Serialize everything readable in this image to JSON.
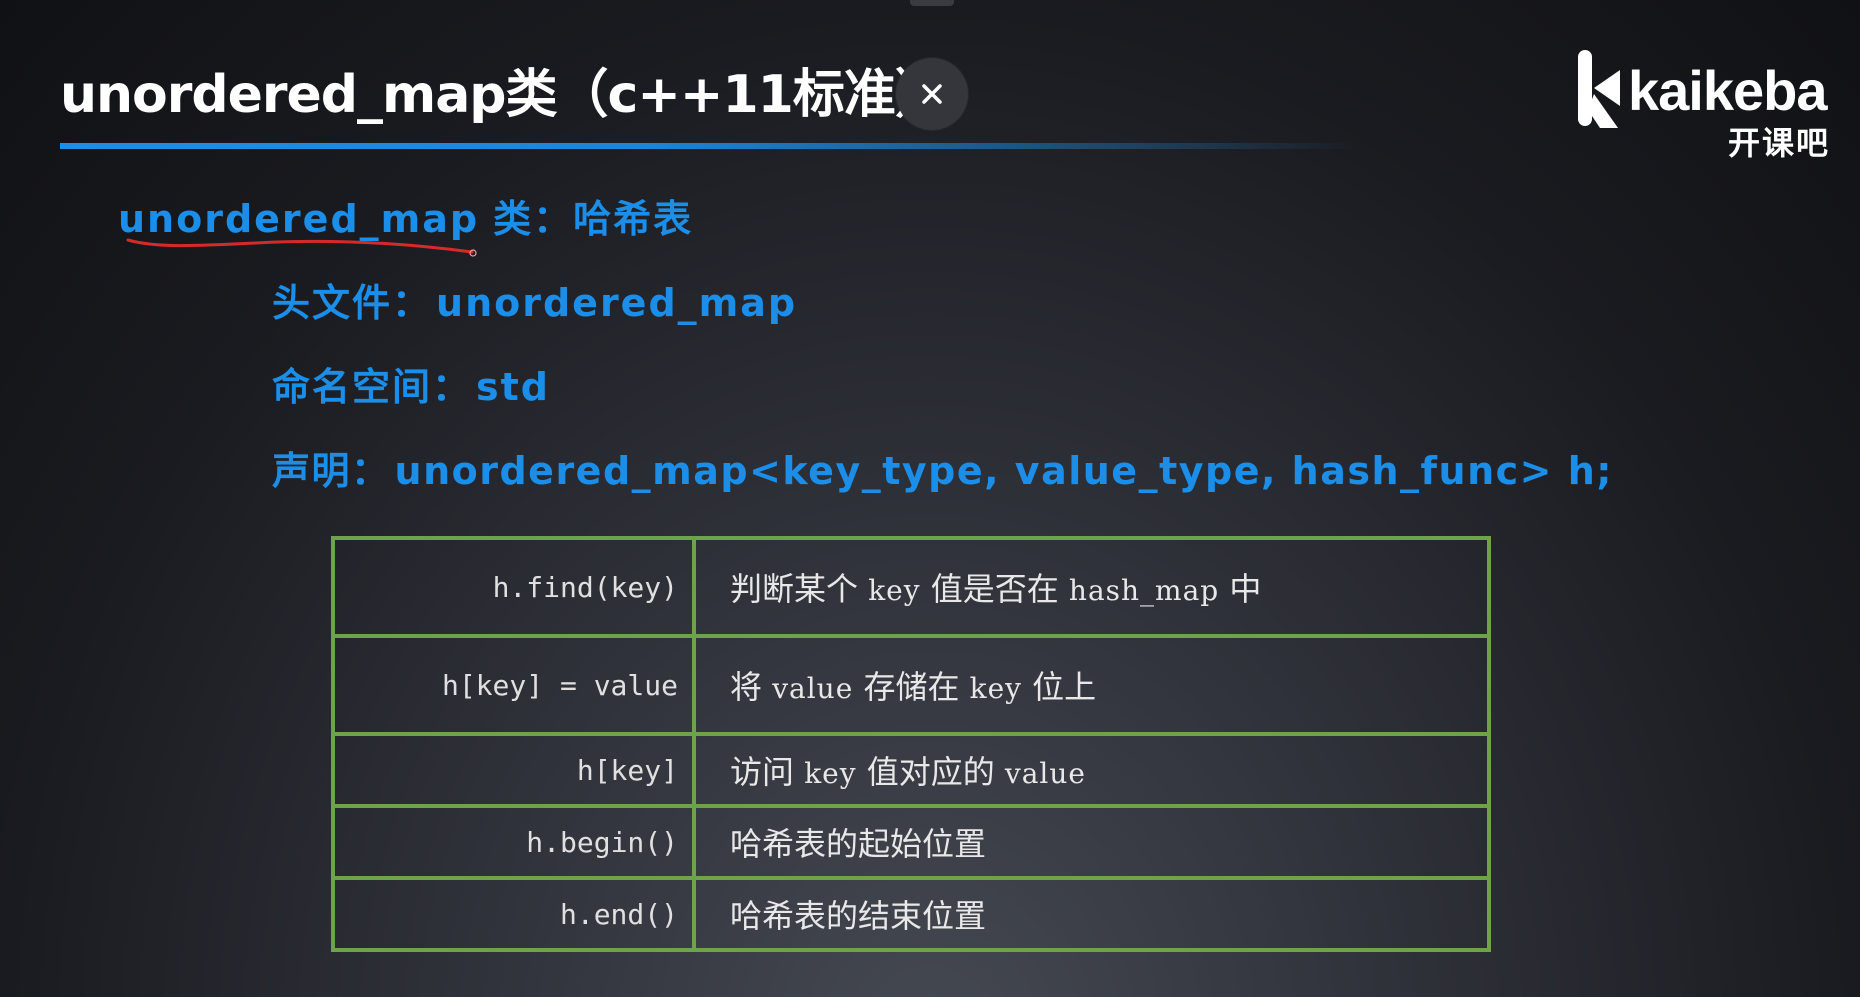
{
  "slide": {
    "title": "unordered_map类（c++11标准）",
    "close_label": "×",
    "logo": {
      "wordmark": "kaikeba",
      "chinese": "开课吧"
    }
  },
  "heading": {
    "term": "unordered_map",
    "label": "类：",
    "text": "哈希表"
  },
  "details": {
    "header_label": "头文件：",
    "header_value": "unordered_map",
    "namespace_label": "命名空间：",
    "namespace_value": "std",
    "decl_label": "声明：",
    "decl_value": "unordered_map<key_type, value_type, hash_func> h;"
  },
  "table": {
    "rows": [
      {
        "op": "h.find(key)",
        "desc": [
          {
            "text": "判断某个 ",
            "mono": false
          },
          {
            "text": "key",
            "mono": true
          },
          {
            "text": " 值是否在 ",
            "mono": false
          },
          {
            "text": "hash_map",
            "mono": true
          },
          {
            "text": " 中",
            "mono": false
          }
        ]
      },
      {
        "op": "h[key] = value",
        "desc": [
          {
            "text": "将 ",
            "mono": false
          },
          {
            "text": "value",
            "mono": true
          },
          {
            "text": " 存储在 ",
            "mono": false
          },
          {
            "text": "key",
            "mono": true
          },
          {
            "text": " 位上",
            "mono": false
          }
        ]
      },
      {
        "op": "h[key]",
        "desc": [
          {
            "text": "访问 ",
            "mono": false
          },
          {
            "text": "key",
            "mono": true
          },
          {
            "text": " 值对应的 ",
            "mono": false
          },
          {
            "text": "value",
            "mono": true
          }
        ]
      },
      {
        "op": "h.begin()",
        "desc": [
          {
            "text": "哈希表的起始位置",
            "mono": false
          }
        ]
      },
      {
        "op": "h.end()",
        "desc": [
          {
            "text": "哈希表的结束位置",
            "mono": false
          }
        ]
      }
    ]
  },
  "colors": {
    "accent_blue": "#1a8ee8",
    "table_border_green": "#6da34a",
    "annotation_red": "#d62a2a"
  }
}
